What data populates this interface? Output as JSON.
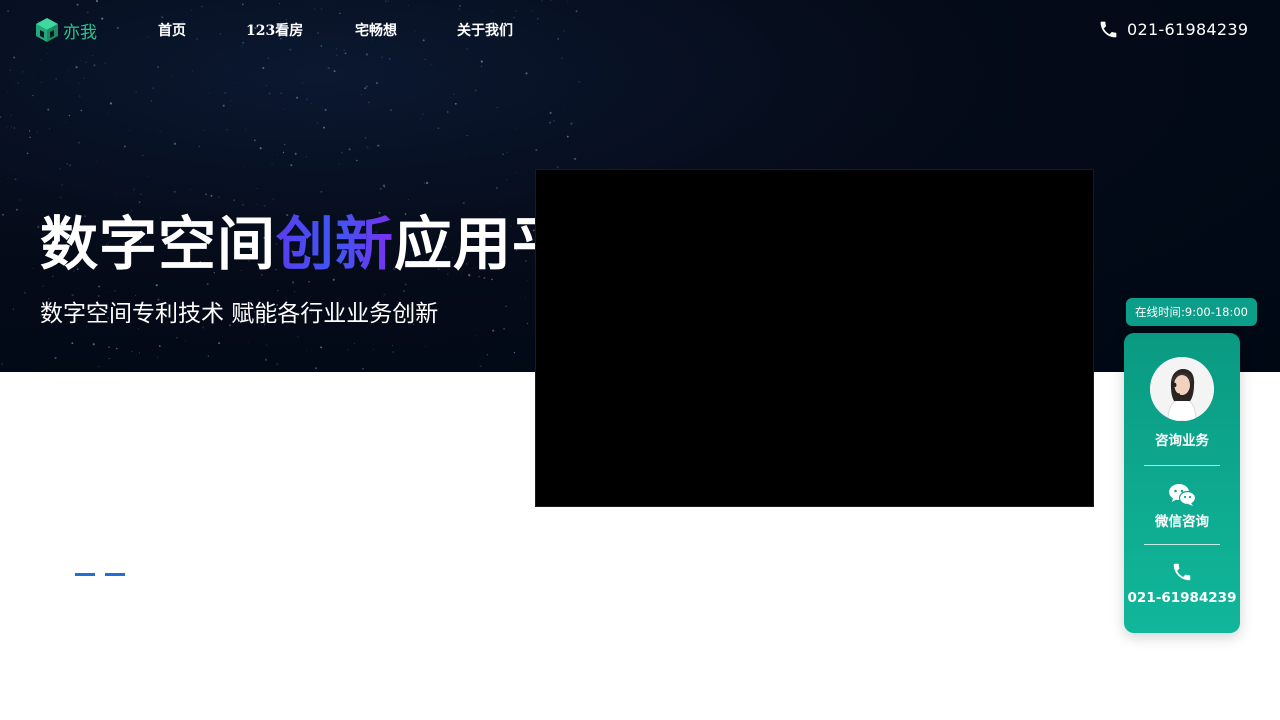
{
  "nav": {
    "logo_text": "亦我",
    "items": [
      {
        "label": "首页"
      },
      {
        "label": "123看房"
      },
      {
        "label": "宅畅想"
      },
      {
        "label": "关于我们"
      }
    ],
    "phone": "021-61984239",
    "phone_icon": "phone-icon"
  },
  "hero": {
    "headline_part1": "数字空间",
    "headline_accent": "创新",
    "headline_part2": "应用平台",
    "subline": "数字空间专利技术 赋能各行业业务创新"
  },
  "consult": {
    "online_hours": "在线时间:9:00-18:00",
    "consult_label": "咨询业务",
    "wechat_label": "微信咨询",
    "phone_label": "021-61984239",
    "icons": [
      "customer-service-avatar",
      "wechat-icon",
      "phone-icon"
    ]
  },
  "colors": {
    "hero_bg": "#050b19",
    "brand_green": "#2fc48d",
    "accent_gradient": [
      "#5b3cf0",
      "#3f57f2",
      "#7a2ff0"
    ],
    "widget_teal": "#0a9a82",
    "dot_blue": "#1f6fd6"
  },
  "slider": {
    "dot_count": 2,
    "active_index": 0
  }
}
